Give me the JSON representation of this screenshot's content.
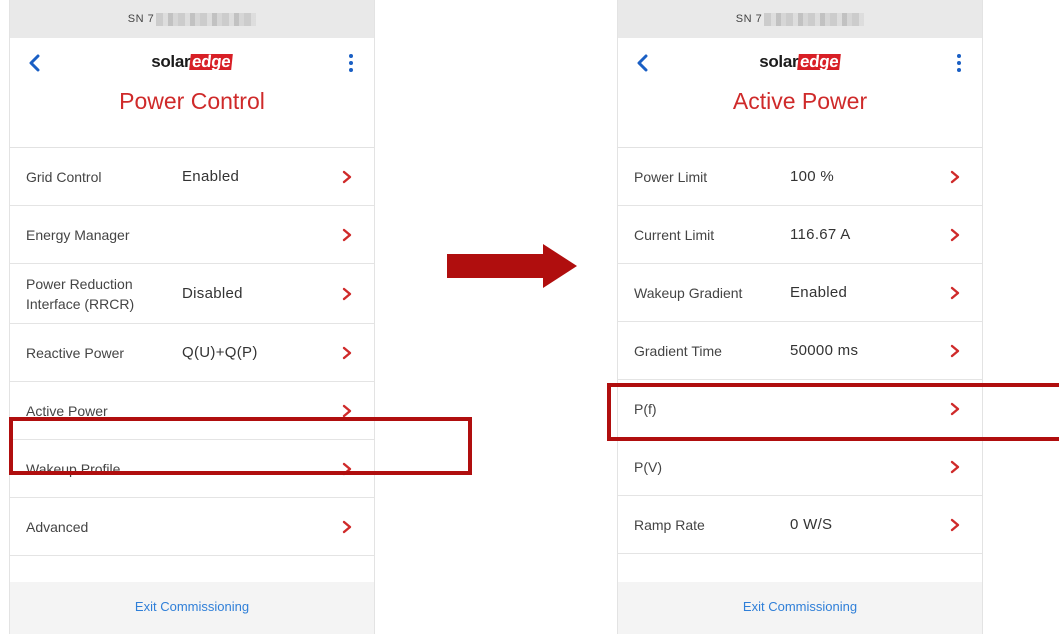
{
  "colors": {
    "accent_red": "#cf2a2a",
    "highlight_red": "#b00e0e",
    "link_blue": "#2f7fd8",
    "icon_blue": "#1a5fc4"
  },
  "left_screen": {
    "status_bar": {
      "serial_prefix": "SN 7"
    },
    "header": {
      "logo_solar": "solar",
      "logo_edge": "edge",
      "title": "Power Control"
    },
    "rows": [
      {
        "label": "Grid Control",
        "value": "Enabled"
      },
      {
        "label": "Energy Manager",
        "value": ""
      },
      {
        "label": "Power Reduction Interface (RRCR)",
        "value": "Disabled"
      },
      {
        "label": "Reactive Power",
        "value": "Q(U)+Q(P)"
      },
      {
        "label": "Active Power",
        "value": ""
      },
      {
        "label": "Wakeup Profile",
        "value": ""
      },
      {
        "label": "Advanced",
        "value": ""
      }
    ],
    "footer": {
      "exit_label": "Exit Commissioning"
    }
  },
  "right_screen": {
    "status_bar": {
      "serial_prefix": "SN 7"
    },
    "header": {
      "logo_solar": "solar",
      "logo_edge": "edge",
      "title": "Active Power"
    },
    "rows": [
      {
        "label": "Power Limit",
        "value": "100 %"
      },
      {
        "label": "Current Limit",
        "value": "116.67 A"
      },
      {
        "label": "Wakeup Gradient",
        "value": "Enabled"
      },
      {
        "label": "Gradient Time",
        "value": "50000 ms"
      },
      {
        "label": "P(f)",
        "value": ""
      },
      {
        "label": "P(V)",
        "value": ""
      },
      {
        "label": "Ramp Rate",
        "value": "0 W/S"
      }
    ],
    "footer": {
      "exit_label": "Exit Commissioning"
    }
  },
  "annotations": {
    "left_highlight_target": "Active Power",
    "right_highlight_target": "P(f)",
    "arrow_icon": "right-arrow-icon"
  }
}
